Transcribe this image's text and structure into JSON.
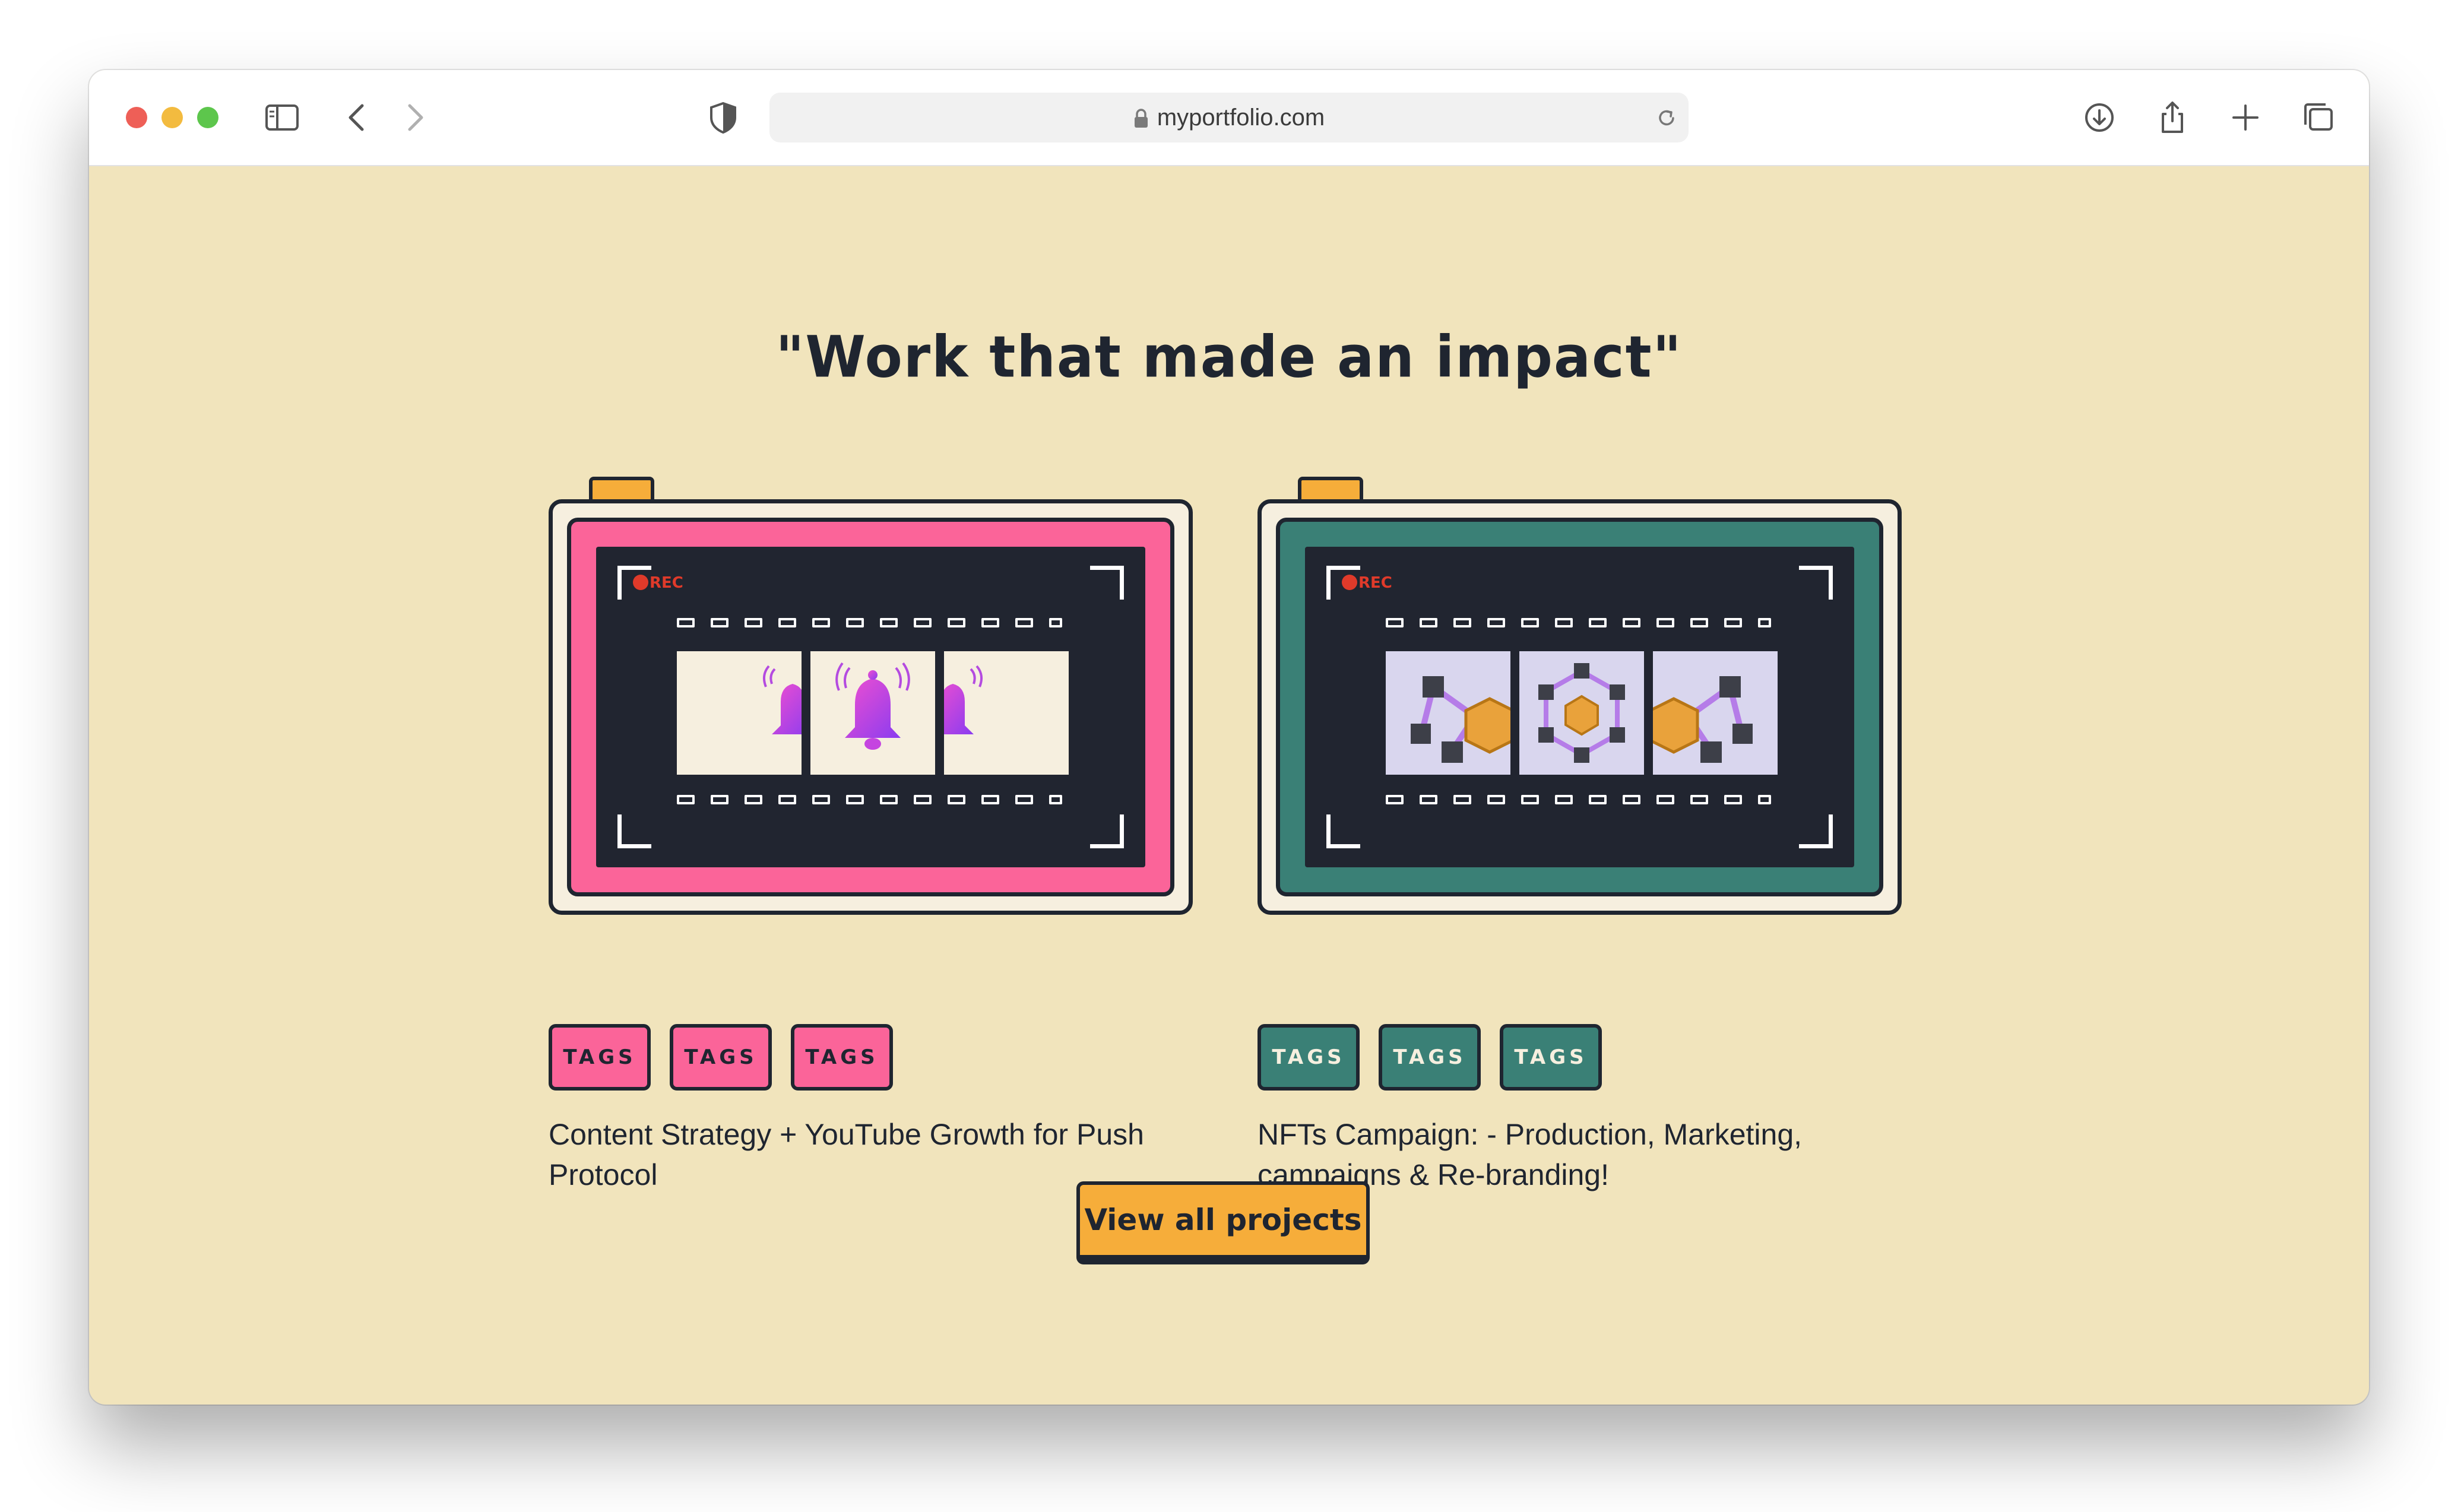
{
  "browser": {
    "url": "myportfolio.com",
    "icons": [
      "sidebar-icon",
      "back-icon",
      "forward-icon",
      "shield-icon",
      "lock-icon",
      "reload-icon",
      "download-icon",
      "share-icon",
      "new-tab-icon",
      "tab-overview-icon"
    ]
  },
  "section": {
    "headline": "\"Work that made an impact\""
  },
  "projects": [
    {
      "tags": [
        "TAGS",
        "TAGS",
        "TAGS"
      ],
      "description": "Content Strategy + YouTube Growth for Push Protocol",
      "rec_label": "REC",
      "accent_color": "#fb6499",
      "tag_text_color": "#1f2530"
    },
    {
      "tags": [
        "TAGS",
        "TAGS",
        "TAGS"
      ],
      "description": "NFTs Campaign: - Production, Marketing, campaigns & Re-branding!",
      "rec_label": "REC",
      "accent_color": "#3a8076",
      "tag_text_color": "#f6efdf"
    }
  ],
  "cta": {
    "label": "View all projects"
  },
  "colors": {
    "page_bg": "#f1e4bc",
    "ink": "#1f2530",
    "orange": "#f6ad3a",
    "screen": "#212530"
  }
}
